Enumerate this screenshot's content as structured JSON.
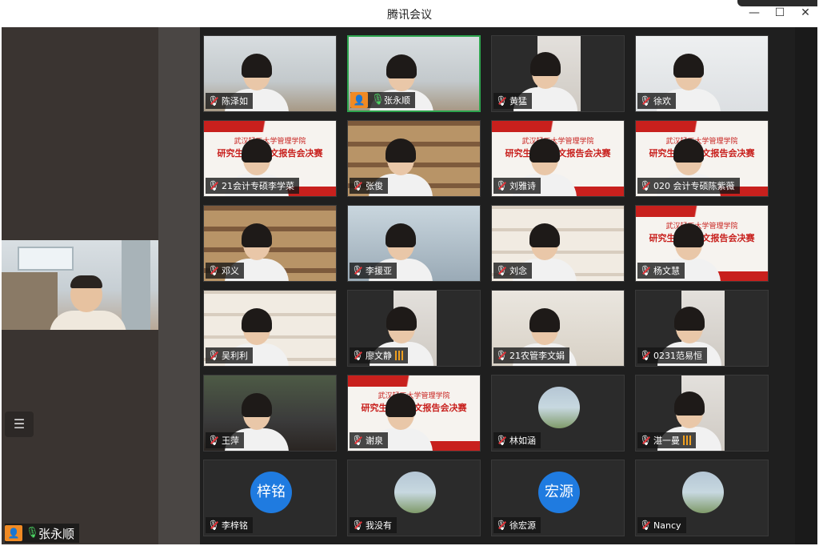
{
  "window": {
    "title": "腾讯会议",
    "minimize_icon": "—",
    "maximize_icon": "☐",
    "close_icon": "✕"
  },
  "side_panel": {
    "menu_icon": "☰",
    "host_badge_icon": "person-icon",
    "host_badge_glyph": "👤",
    "mic_glyph": "🎙",
    "speaker_name": "张永顺"
  },
  "gallery": {
    "tiles": [
      {
        "name": "陈泽如",
        "scene": "room",
        "muted": true
      },
      {
        "name": "张永顺",
        "scene": "room",
        "muted": false,
        "host": true,
        "active": true
      },
      {
        "name": "黄猛",
        "scene": "dark",
        "muted": true
      },
      {
        "name": "徐欢",
        "scene": "officebright",
        "muted": true
      },
      {
        "name": "21会计专硕李学菜",
        "scene": "banner",
        "muted": true
      },
      {
        "name": "张俊",
        "scene": "books",
        "muted": true
      },
      {
        "name": "刘雅诗",
        "scene": "banner",
        "muted": true
      },
      {
        "name": "020 会计专硕陈紫薇",
        "scene": "banner",
        "muted": true
      },
      {
        "name": "邓义",
        "scene": "books",
        "muted": true
      },
      {
        "name": "李援亚",
        "scene": "blue",
        "muted": true
      },
      {
        "name": "刘念",
        "scene": "shelf-white",
        "muted": true
      },
      {
        "name": "杨文慧",
        "scene": "banner",
        "muted": true
      },
      {
        "name": "吴利利",
        "scene": "shelf-white",
        "muted": true
      },
      {
        "name": "廖文静",
        "scene": "dark",
        "muted": true,
        "speaking": true
      },
      {
        "name": "21农管李文娟",
        "scene": "cream",
        "muted": true
      },
      {
        "name": "0231范易恒",
        "scene": "dark",
        "muted": true
      },
      {
        "name": "王萍",
        "scene": "car",
        "muted": true
      },
      {
        "name": "谢泉",
        "scene": "banner",
        "muted": true
      },
      {
        "name": "林如涵",
        "scene": "dark",
        "muted": true,
        "avatar": "photo"
      },
      {
        "name": "湛一曼",
        "scene": "dark",
        "muted": true,
        "speaking": true
      },
      {
        "name": "李梓铭",
        "scene": "dark",
        "muted": true,
        "avatar": "text",
        "avatar_text": "梓铭"
      },
      {
        "name": "我没有",
        "scene": "dark",
        "muted": true,
        "avatar": "photo"
      },
      {
        "name": "徐宏源",
        "scene": "dark",
        "muted": true,
        "avatar": "text",
        "avatar_text": "宏源"
      },
      {
        "name": "Nancy",
        "scene": "dark",
        "muted": true,
        "avatar": "photo"
      }
    ],
    "banner": {
      "line1": "武汉轻工大学管理学院",
      "line2": "研究生科技论文报告会决赛"
    }
  },
  "colors": {
    "accent_green": "#2da44e",
    "host_orange": "#f08a24",
    "avatar_blue": "#1f7be0",
    "banner_red": "#c8201d"
  }
}
